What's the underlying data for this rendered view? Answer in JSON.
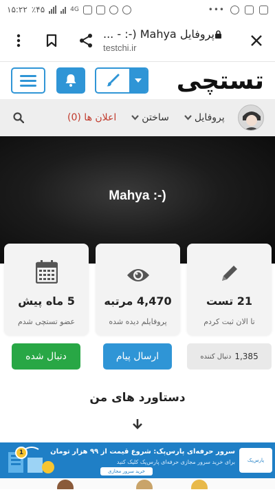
{
  "status_bar": {
    "time": "۱۵:۲۲",
    "battery": "٪۴۵",
    "network": "4G"
  },
  "browser": {
    "page_title": "پروفایل Mahya (-: - ...",
    "url": "testchi.ir"
  },
  "site": {
    "logo": "تستچی"
  },
  "nav": {
    "profile": "پروفایل",
    "build": "ساختن",
    "notifications": "اعلان ها (0)"
  },
  "hero": {
    "name": "Mahya :-)"
  },
  "stats": [
    {
      "value": "21 تست",
      "label": "تا الان ثبت کردم",
      "icon": "pencil-icon"
    },
    {
      "value": "4,470 مرتبه",
      "label": "پروفایلم دیده شده",
      "icon": "eye-icon"
    },
    {
      "value": "5 ماه پیش",
      "label": "عضو تستچی شدم",
      "icon": "calendar-icon"
    }
  ],
  "actions": {
    "followers_count": "1,385",
    "followers_label": "دنبال کننده",
    "send_message": "ارسال پیام",
    "followed": "دنبال شده"
  },
  "achievements": {
    "title": "دستاورد های من"
  },
  "ad": {
    "headline": "سرور حرفه‌ای پارس‌پک: شروع قیمت از ۹۹ هزار تومان",
    "subline": "برای خرید سرور مجازی حرفه‌ای پارس‌پک کلیک کنید",
    "button": "خرید سرور مجازی",
    "logo": "پارس‌پک",
    "badge": "1"
  },
  "colors": {
    "brand_blue": "#2f95d6",
    "follow_green": "#28a745",
    "notif_red": "#c0392b"
  }
}
